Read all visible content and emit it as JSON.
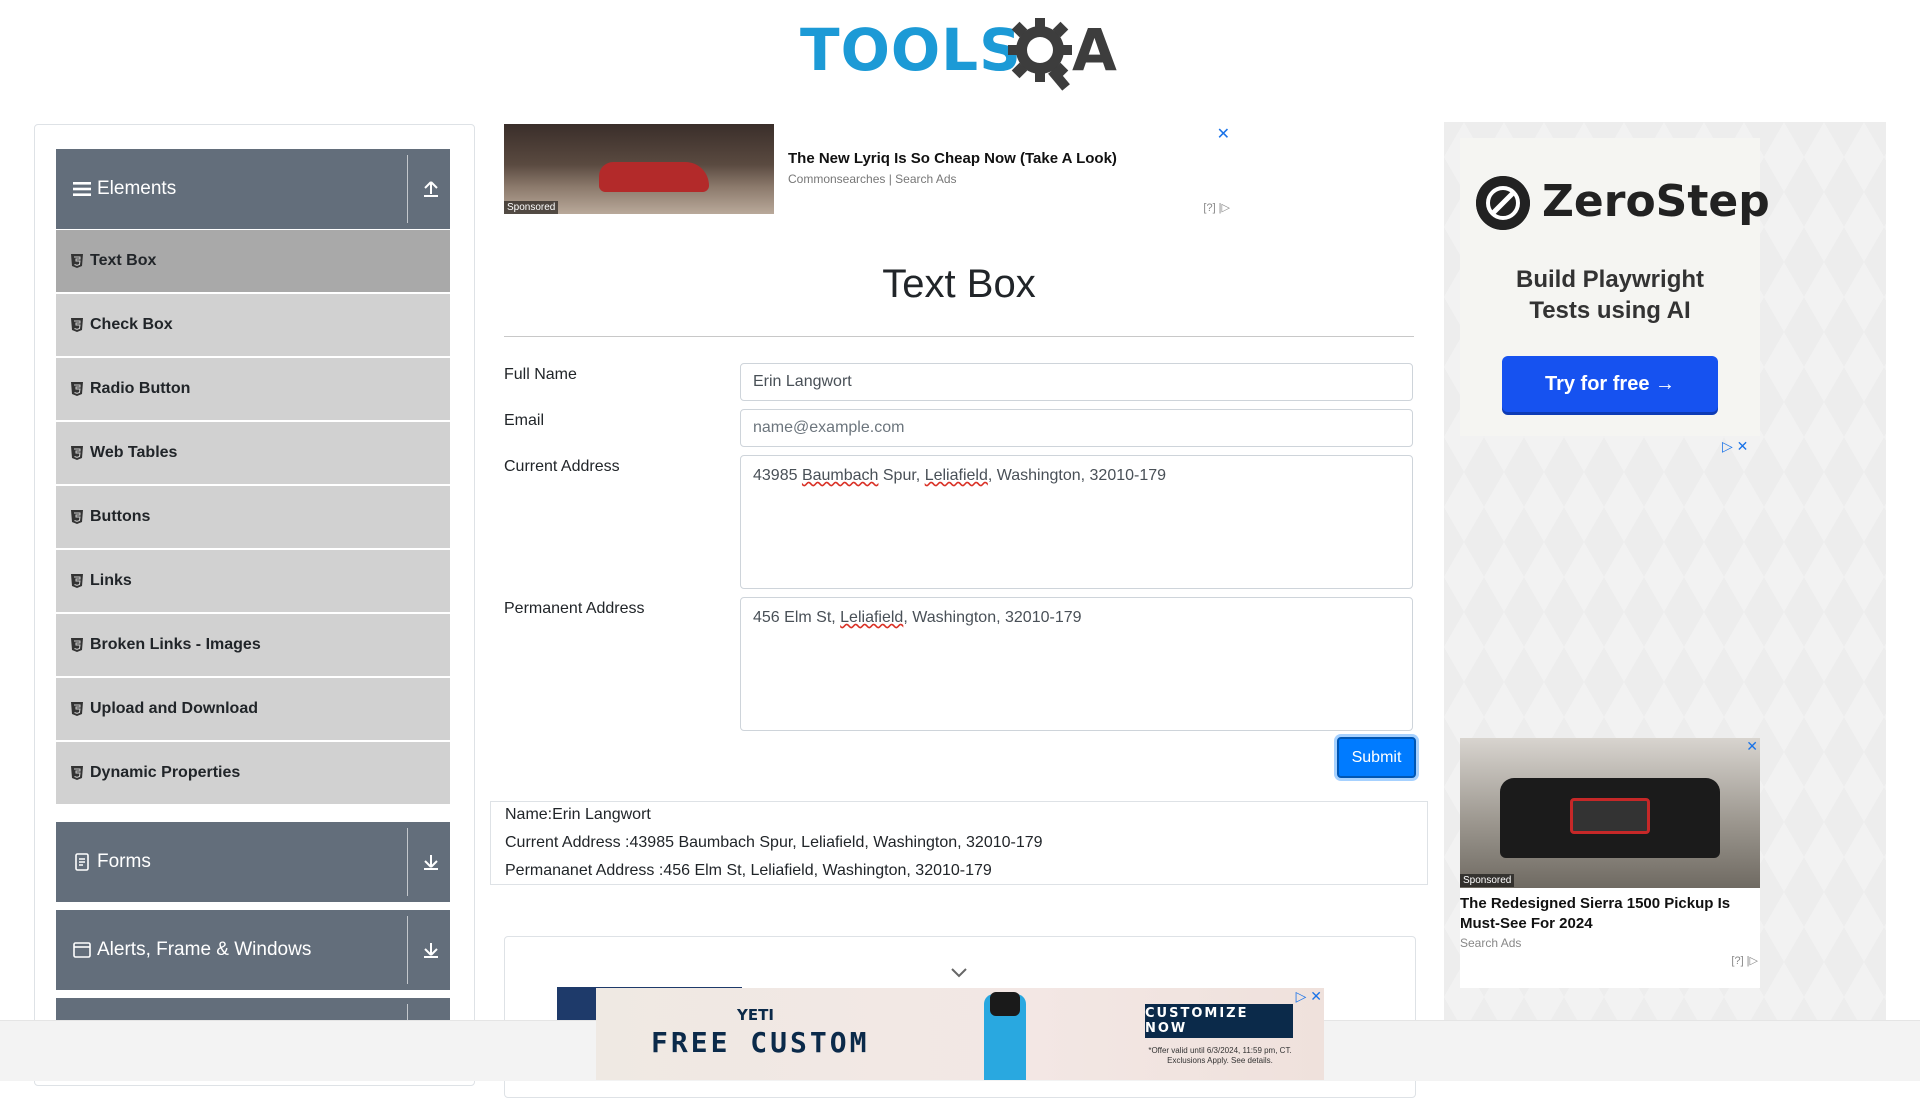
{
  "header": {
    "logo_text_left": "TOOLS",
    "logo_text_right": "A",
    "logo_accent": "#1c9ad6"
  },
  "sidebar": {
    "groups": [
      {
        "title": "Elements",
        "icon": "hamburger-icon",
        "state": "expanded",
        "arrow_icon": "upload-arrow-icon"
      },
      {
        "title": "Forms",
        "icon": "document-icon",
        "state": "collapsed",
        "arrow_icon": "download-arrow-icon"
      },
      {
        "title": "Alerts, Frame & Windows",
        "icon": "window-icon",
        "state": "collapsed",
        "arrow_icon": "download-arrow-icon"
      }
    ],
    "items": [
      {
        "label": "Text Box",
        "active": true
      },
      {
        "label": "Check Box",
        "active": false
      },
      {
        "label": "Radio Button",
        "active": false
      },
      {
        "label": "Web Tables",
        "active": false
      },
      {
        "label": "Buttons",
        "active": false
      },
      {
        "label": "Links",
        "active": false
      },
      {
        "label": "Broken Links - Images",
        "active": false
      },
      {
        "label": "Upload and Download",
        "active": false
      },
      {
        "label": "Dynamic Properties",
        "active": false
      }
    ]
  },
  "top_ad": {
    "headline": "The New Lyriq Is So Cheap Now (Take A Look)",
    "source": "Commonsearches | Search Ads",
    "sponsored": "Sponsored",
    "close": "✕",
    "adchoice": "[?] |▷"
  },
  "main": {
    "title": "Text Box"
  },
  "form": {
    "full_name_label": "Full Name",
    "full_name_value": "Erin Langwort",
    "email_label": "Email",
    "email_placeholder": "name@example.com",
    "current_address_label": "Current Address",
    "current_address_parts": [
      "43985 ",
      "Baumbach",
      " Spur, ",
      "Leliafield",
      ", Washington, 32010-179"
    ],
    "permanent_address_label": "Permanent Address",
    "permanent_address_parts": [
      "456 Elm St, ",
      "Leliafield",
      ", Washington, 32010-179"
    ],
    "submit_label": "Submit"
  },
  "output": {
    "name": "Name:Erin Langwort",
    "current_address": "Current Address :43985 Baumbach Spur, Leliafield, Washington, 32010-179",
    "permanent_address": "Permananet Address :456 Elm St, Leliafield, Washington, 32010-179"
  },
  "right_ads": {
    "zerostep": {
      "brand": "ZeroStep",
      "tagline_line1": "Build Playwright",
      "tagline_line2": "Tests using AI",
      "button": "Try for free →",
      "button_color": "#1652f0"
    },
    "adchoice_close": "▷ ✕",
    "truck": {
      "headline": "The Redesigned Sierra 1500 Pickup Is Must-See For 2024",
      "source": "Search Ads",
      "sponsored": "Sponsored",
      "close": "✕",
      "adchoice": "[?] |▷"
    }
  },
  "bottom_ad": {
    "brand": "YETI",
    "offer": "FREE CUSTOM",
    "cta": "CUSTOMIZE NOW",
    "fine_print": "*Offer valid until 6/3/2024, 11:59 pm, CT. Exclusions Apply. See details.",
    "close": "▷ ✕"
  }
}
